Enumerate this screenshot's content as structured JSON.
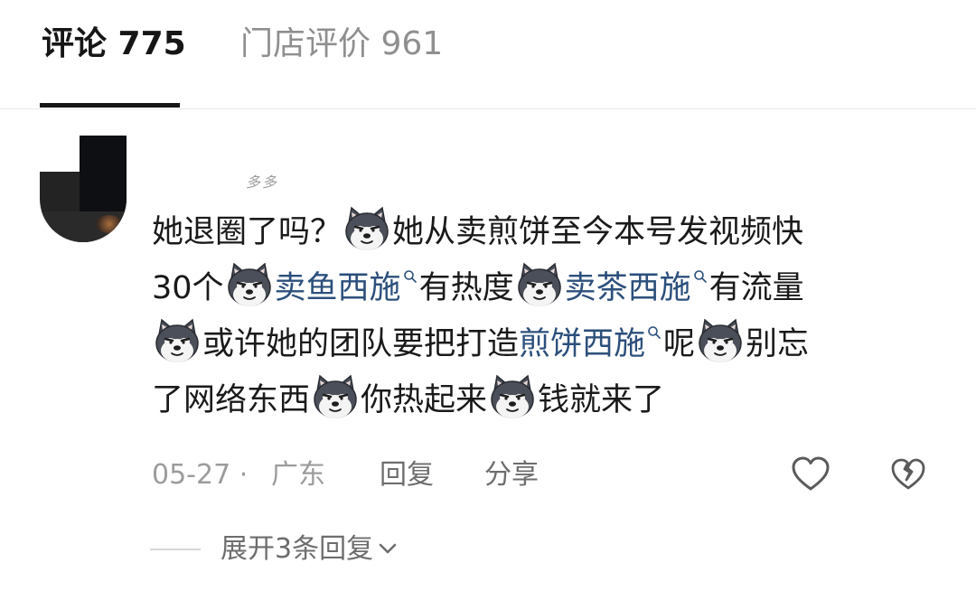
{
  "tabs": {
    "comments": "评论 775",
    "store_reviews": "门店评价 961"
  },
  "comment": {
    "username": "多多",
    "emoji_icon": "husky-smirk-emoji",
    "segments": {
      "s1": "她退圈了吗？",
      "s2": "她从卖煎饼至今本号发视频快",
      "s3": "30个",
      "tag1": "卖鱼西施",
      "s4": "有热度",
      "tag2": "卖茶西施",
      "s5": "有流量",
      "s6": "或许她的团队要把打造",
      "tag3": "煎饼西施",
      "s7": "呢",
      "s8": "别忘",
      "s9": "了网络东西",
      "s10": "你热起来",
      "s11": "钱就来了"
    },
    "date": "05-27 ·",
    "location": "广东",
    "reply_label": "回复",
    "share_label": "分享",
    "expand_label": "展开3条回复"
  },
  "colors": {
    "highlight": "#2c4f7c",
    "muted": "#9c9c9c",
    "text": "#1a1a1a"
  }
}
